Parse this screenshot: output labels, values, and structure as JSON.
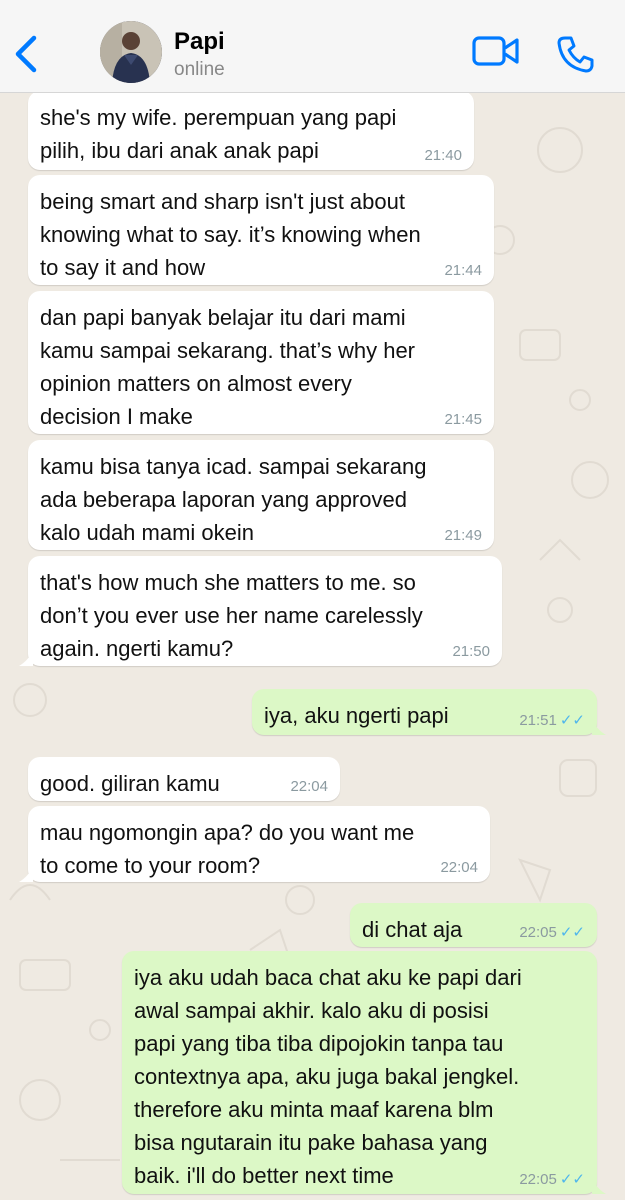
{
  "header": {
    "contact_name": "Papi",
    "status": "online",
    "icons": [
      "chevron-left-icon",
      "video-camera-icon",
      "phone-icon"
    ],
    "accent_color": "#007aff"
  },
  "messages": [
    {
      "dir": "in",
      "text": "she's my wife. perempuan yang papi\npilih, ibu dari anak anak papi",
      "time": "21:40"
    },
    {
      "dir": "in",
      "text": "being smart and sharp isn't just about\nknowing what to say. it’s knowing when\nto say it and how",
      "time": "21:44"
    },
    {
      "dir": "in",
      "text": "dan papi banyak belajar itu dari mami\nkamu sampai sekarang. that’s why her\nopinion matters on almost every\ndecision I make",
      "time": "21:45"
    },
    {
      "dir": "in",
      "text": "kamu bisa tanya icad. sampai sekarang\nada beberapa laporan yang approved\nkalo udah mami okein",
      "time": "21:49"
    },
    {
      "dir": "in",
      "text": "that's how much she matters to me. so\ndon’t you ever use her name carelessly\nagain. ngerti kamu?",
      "time": "21:50"
    },
    {
      "dir": "out",
      "text": "iya, aku ngerti papi",
      "time": "21:51"
    },
    {
      "dir": "in",
      "text": "good. giliran kamu",
      "time": "22:04"
    },
    {
      "dir": "in",
      "text": "mau ngomongin apa? do you want me\nto come to your room?",
      "time": "22:04"
    },
    {
      "dir": "out",
      "text": "di chat aja",
      "time": "22:05"
    },
    {
      "dir": "out",
      "text": "iya aku udah baca chat aku ke papi dari\nawal sampai akhir. kalo aku di posisi\npapi yang tiba tiba dipojokin tanpa tau\ncontextnya apa, aku juga bakal jengkel.\ntherefore aku minta maaf karena blm\nbisa ngutarain itu pake bahasa yang\nbaik. i'll do better next time",
      "time": "22:05"
    }
  ],
  "read_receipt": "✓✓",
  "colors": {
    "incoming_bubble": "#ffffff",
    "outgoing_bubble": "#dcf8c6",
    "chat_background": "#efeae2",
    "read_ticks": "#4fb6ec"
  }
}
